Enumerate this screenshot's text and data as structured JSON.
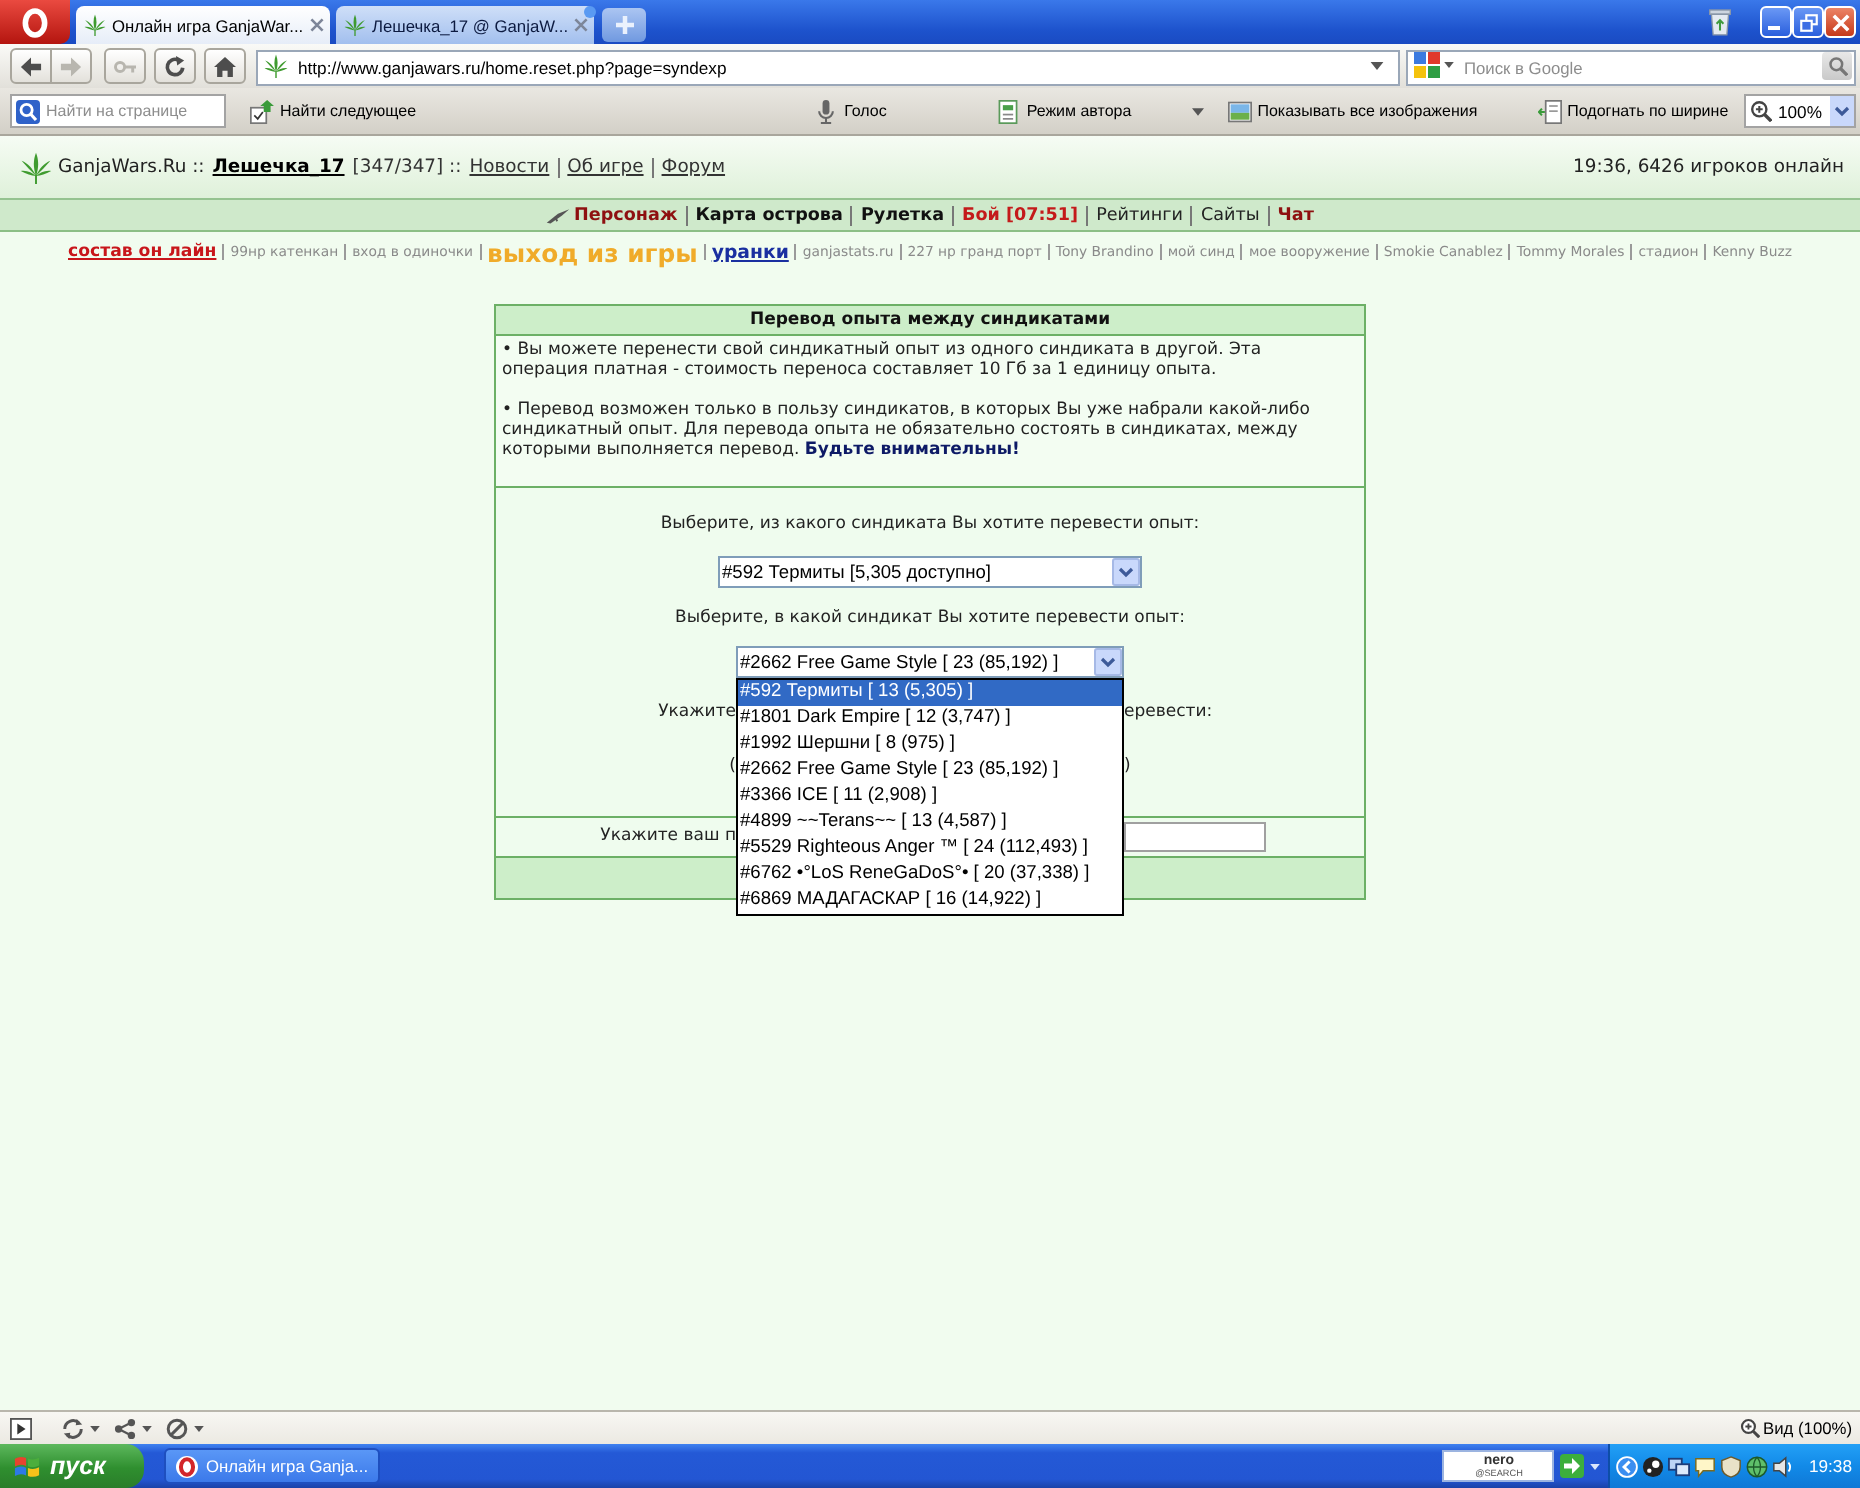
{
  "browser": {
    "tabs": [
      {
        "title": "Онлайн игра GanjaWar...",
        "selected": true,
        "notify": false
      },
      {
        "title": "Лешечка_17 @ GanjaW...",
        "selected": false,
        "notify": true
      }
    ],
    "nav_buttons": [
      {
        "kind": "back",
        "disabled": false
      },
      {
        "kind": "forward",
        "disabled": true
      },
      {
        "kind": "key",
        "disabled": true
      },
      {
        "kind": "reload",
        "disabled": false
      },
      {
        "kind": "home",
        "disabled": false
      }
    ],
    "address": "http://www.ganjawars.ru/home.reset.php?page=syndexp",
    "search": {
      "placeholder": "Поиск в Google"
    },
    "find": {
      "placeholder": "Найти на странице"
    },
    "toolbar": [
      {
        "kind": "find",
        "label": "Найти следующее"
      },
      {
        "kind": "voice",
        "label": "Голос"
      },
      {
        "kind": "author",
        "label": "Режим автора"
      },
      {
        "kind": "images",
        "label": "Показывать все изображения"
      },
      {
        "kind": "fit",
        "label": "Подогнать по ширине"
      }
    ],
    "zoom": "100%"
  },
  "site": {
    "brand": "GanjaWars.Ru ::",
    "user": "Лешечка_17",
    "hp": "[347/347] ::",
    "menu": [
      "Новости",
      "Об игре",
      "Форум"
    ],
    "online": "19:36, 6426 игроков онлайн",
    "nav": [
      {
        "label": "Персонаж",
        "kind": "accent"
      },
      {
        "label": "Карта острова",
        "kind": "strong"
      },
      {
        "label": "Рулетка",
        "kind": "strong"
      },
      {
        "label": "Бой [07:51]",
        "kind": "alert"
      },
      {
        "label": "Рейтинги",
        "kind": "plain"
      },
      {
        "label": "Сайты",
        "kind": "plain"
      },
      {
        "label": "Чат",
        "kind": "accent"
      }
    ],
    "quick_links": [
      {
        "label": "состав он лайн",
        "kind": "hot"
      },
      {
        "label": "99нр катенкан",
        "kind": "small"
      },
      {
        "label": "вход в одиночки",
        "kind": "small"
      },
      {
        "label": "выход из игры",
        "kind": "exit"
      },
      {
        "label": "уранки",
        "kind": "bold"
      },
      {
        "label": "ganjastats.ru",
        "kind": "small"
      },
      {
        "label": "227 нр гранд порт",
        "kind": "small"
      },
      {
        "label": "Tony Brandino",
        "kind": "small"
      },
      {
        "label": "мой синд",
        "kind": "small"
      },
      {
        "label": "мое вооружение",
        "kind": "small"
      },
      {
        "label": "Smokie Canablez",
        "kind": "small"
      },
      {
        "label": "Tommy Morales",
        "kind": "small"
      },
      {
        "label": "стадион",
        "kind": "small"
      },
      {
        "label": "Kenny Buzz",
        "kind": "small"
      }
    ]
  },
  "panel": {
    "title": "Перевод опыта между синдикатами",
    "notes": [
      "• Вы можете перенести свой синдикатный опыт из одного синдиката в другой. Эта операция платная - стоимость переноса составляет 10 Гб за 1 единицу опыта.",
      "• Перевод возможен только в пользу синдикатов, в которых Вы уже набрали какой-либо синдикатный опыт. Для перевода опыта не обязательно состоять в синдикатах, между которыми выполняется перевод. **Будьте внимательны!**"
    ],
    "source_prompt": "Выберите, из какого синдиката Вы хотите перевести опыт:",
    "source_select": "#592 Термиты [5,305 доступно]",
    "target_prompt": "Выберите, в какой синдикат Вы хотите перевести опыт:",
    "target_select": "#2662 Free Game Style [ 23 (85,192) ]",
    "target_options": [
      {
        "label": "#592 Термиты [ 13 (5,305) ]",
        "selected": true
      },
      {
        "label": "#1801 Dark Empire [ 12 (3,747) ]",
        "selected": false
      },
      {
        "label": "#1992 Шершни [ 8 (975) ]",
        "selected": false
      },
      {
        "label": "#2662 Free Game Style [ 23 (85,192) ]",
        "selected": false
      },
      {
        "label": "#3366 ICE [ 11 (2,908) ]",
        "selected": false
      },
      {
        "label": "#4899 ~~Terans~~ [ 13 (4,587) ]",
        "selected": false
      },
      {
        "label": "#5529 Righteous Anger ™ [ 24 (112,493) ]",
        "selected": false
      },
      {
        "label": "#6762 •°LoS ReneGaDoS°• [ 20 (37,338) ]",
        "selected": false
      },
      {
        "label": "#6869 МАДАГАСКАР [ 16 (14,922) ]",
        "selected": false
      }
    ],
    "amount_prompt": {
      "before": "Укажите",
      "after": "еревести:"
    },
    "amount_hint": {
      "before": "(",
      "after": ")"
    },
    "password_prompt": "Укажите ваш п"
  },
  "status_bar": {
    "zoom": "Вид (100%)"
  },
  "taskbar": {
    "start": "пуск",
    "tasks": [
      "Онлайн игра Ganja..."
    ],
    "search_band": {
      "logo": "nero",
      "tag": "@SEARCH"
    },
    "clock": "19:38"
  }
}
